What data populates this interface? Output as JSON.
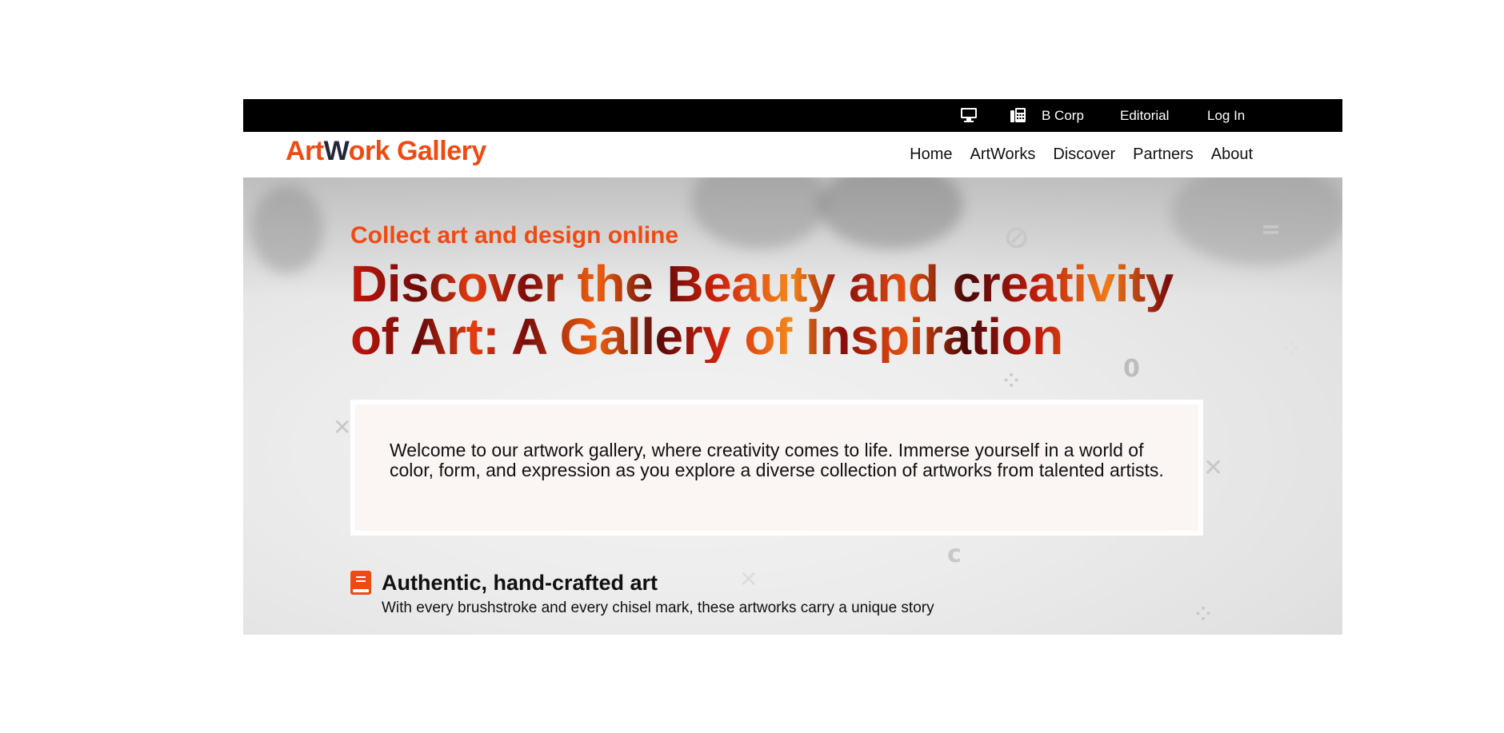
{
  "topbar": {
    "icons": [
      "desktop-icon",
      "fax-icon"
    ],
    "links": [
      "B Corp",
      "Editorial",
      "Log In"
    ]
  },
  "logo": {
    "part1": "Art",
    "part2": "W",
    "part3": "ork Gallery"
  },
  "nav": {
    "items": [
      "Home",
      "ArtWorks",
      "Discover",
      "Partners",
      "About"
    ]
  },
  "hero": {
    "eyebrow": "Collect art and design online",
    "headline": "Discover the Beauty and creativity of Art: A Gallery of Inspiration",
    "welcome": "Welcome to our artwork gallery, where creativity comes to life. Immerse yourself in a world of color, form, and expression as you explore a diverse collection of artworks from talented artists.",
    "feature": {
      "icon": "book-icon",
      "title": "Authentic, hand-crafted art",
      "subtitle": "With every brushstroke and every chisel mark, these artworks carry a unique story"
    }
  },
  "colors": {
    "accent": "#f04a13",
    "logo_dark": "#24263a",
    "topbar_bg": "#000000",
    "welcome_bg": "#fbf5f4"
  }
}
